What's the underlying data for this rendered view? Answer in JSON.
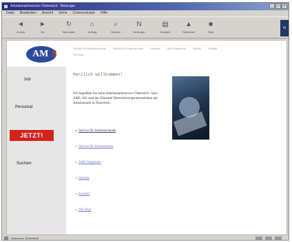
{
  "window": {
    "title": "Arbeitsmarktservice Österreich - Netscape",
    "controls": [
      "_",
      "□",
      "×"
    ]
  },
  "menubar": [
    "Datei",
    "Bearbeiten",
    "Ansicht",
    "Gehe",
    "Communicator",
    "Hilfe"
  ],
  "toolbar": {
    "buttons": [
      {
        "label": "Zurück",
        "icon": "back-arrow-icon",
        "glyph": "◄"
      },
      {
        "label": "Vor",
        "icon": "forward-arrow-icon",
        "glyph": "►"
      },
      {
        "label": "Neu laden",
        "icon": "reload-icon",
        "glyph": "↻"
      },
      {
        "label": "Anfang",
        "icon": "home-icon",
        "glyph": "⌂"
      },
      {
        "label": "Suchen",
        "icon": "search-icon",
        "glyph": "⌕"
      },
      {
        "label": "Netscape",
        "icon": "netscape-icon",
        "glyph": "N"
      },
      {
        "label": "Drucken",
        "icon": "print-icon",
        "glyph": "▤"
      },
      {
        "label": "Sicherheit",
        "icon": "security-icon",
        "glyph": "▲"
      },
      {
        "label": "Stop",
        "icon": "stop-icon",
        "glyph": "■"
      }
    ],
    "throbber": "N"
  },
  "page": {
    "logo": {
      "am": "AM",
      "s": "S",
      "brand_blue": "#2a4a9a",
      "brand_red": "#e2411c"
    },
    "top_nav": [
      "Service für Arbeitsuchende",
      "Service für Unternehmen",
      "Inserate",
      "AMS Allgemein",
      "Aktuell",
      "Kontakt",
      "Site Map"
    ],
    "sidebar": {
      "job_label": "Job",
      "personal_label": "Personal",
      "jetzt_label": "JETZT!",
      "search_label": "Suchen",
      "jetzt_color": "#d2231c"
    },
    "content": {
      "greeting": "Herzlich willkommen!",
      "intro": "Wir begrüßen Sie beim Arbeitsmarktservice Österreich - kurz AMS. Wir sind der führende Dienstleistungsunternehmen am Arbeitsmarkt in Österreich.",
      "links": [
        "Service für Arbeitsuchende",
        "Service für Unternehmen",
        "AMS Allgemein",
        "Inserate",
        "Kontakt",
        "Site Map"
      ]
    }
  },
  "statusbar": {
    "text": "Dokument: Übermittelt"
  }
}
